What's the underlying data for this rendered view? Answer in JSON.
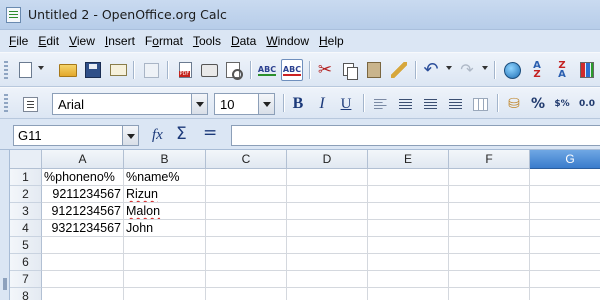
{
  "window": {
    "title": "Untitled 2 - OpenOffice.org Calc"
  },
  "menubar": {
    "items": [
      {
        "label_u": "F",
        "label_rest": "ile"
      },
      {
        "label_u": "E",
        "label_rest": "dit"
      },
      {
        "label_u": "V",
        "label_rest": "iew"
      },
      {
        "label_u": "I",
        "label_rest": "nsert"
      },
      {
        "label_pre": "F",
        "label_u": "o",
        "label_rest": "rmat"
      },
      {
        "label_u": "T",
        "label_rest": "ools"
      },
      {
        "label_u": "D",
        "label_rest": "ata"
      },
      {
        "label_u": "W",
        "label_rest": "indow"
      },
      {
        "label_u": "H",
        "label_rest": "elp"
      }
    ]
  },
  "toolbar_standard": {
    "icons": [
      "new-icon",
      "open-icon",
      "save-icon",
      "email-icon",
      "edit-file-icon",
      "export-pdf-icon",
      "print-icon",
      "page-preview-icon",
      "spellcheck-icon",
      "autospellcheck-icon",
      "cut-icon",
      "copy-icon",
      "paste-icon",
      "clone-formatting-icon",
      "undo-icon",
      "redo-icon",
      "navigator-icon",
      "sort-ascending-icon",
      "sort-descending-icon",
      "chart-icon"
    ]
  },
  "toolbar_formatting": {
    "font_name": "Arial",
    "font_size": "10",
    "bold": "B",
    "italic": "I",
    "underline": "U",
    "currency_icon": "currency-icon",
    "percent": "%",
    "number_format": "$%",
    "decimal_format": "0.0"
  },
  "formula_bar": {
    "name_box": "G11",
    "fx": "fx",
    "sigma": "Σ",
    "equals": "=",
    "formula": ""
  },
  "sheet": {
    "columns": [
      "A",
      "B",
      "C",
      "D",
      "E",
      "F",
      "G"
    ],
    "selected_column": "G",
    "rows": [
      "1",
      "2",
      "3",
      "4",
      "5",
      "6",
      "7",
      "8"
    ],
    "cells": {
      "A1": "%phoneno%",
      "B1": "%name%",
      "A2": "9211234567",
      "B2": "Rizun",
      "A3": "9121234567",
      "B3": "Malon",
      "A4": "9321234567",
      "B4": "John"
    }
  },
  "colors": {
    "selected_header": "#3a7ccc",
    "chrome": "#dbe6f4",
    "spell_underline": "#d02020"
  }
}
